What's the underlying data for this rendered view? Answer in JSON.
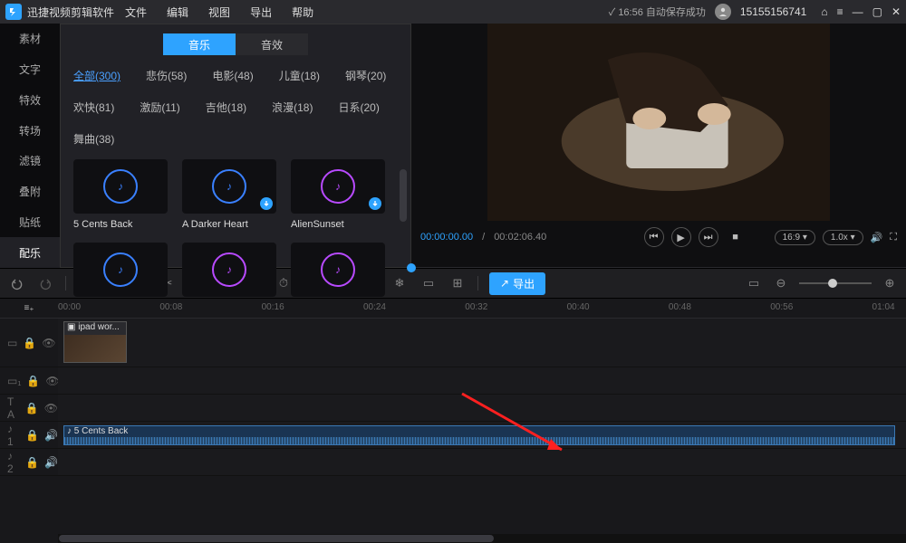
{
  "titlebar": {
    "app_name": "迅捷视频剪辑软件",
    "menus": [
      "文件",
      "编辑",
      "视图",
      "导出",
      "帮助"
    ],
    "save_status": "✓ 16:56 自动保存成功",
    "user_id": "15155156741"
  },
  "sidebar": {
    "items": [
      "素材",
      "文字",
      "特效",
      "转场",
      "滤镜",
      "叠附",
      "贴纸",
      "配乐"
    ],
    "active_index": 7
  },
  "library": {
    "tabs": {
      "music": "音乐",
      "sfx": "音效",
      "active": 0
    },
    "categories": [
      {
        "label": "全部(300)",
        "active": true
      },
      {
        "label": "悲伤(58)"
      },
      {
        "label": "电影(48)"
      },
      {
        "label": "儿童(18)"
      },
      {
        "label": "钢琴(20)"
      },
      {
        "label": "欢快(81)"
      },
      {
        "label": "激励(11)"
      },
      {
        "label": "吉他(18)"
      },
      {
        "label": "浪漫(18)"
      },
      {
        "label": "日系(20)"
      },
      {
        "label": "舞曲(38)"
      }
    ],
    "tracks": [
      {
        "name": "5 Cents Back",
        "color": "c-blue",
        "dl": false
      },
      {
        "name": "A Darker Heart",
        "color": "c-blue",
        "dl": true
      },
      {
        "name": "AlienSunset",
        "color": "c-purple",
        "dl": true
      }
    ]
  },
  "preview": {
    "cur_time": "00:00:00.00",
    "total_time": "00:02:06.40",
    "aspect": "16:9 ▾",
    "speed": "1.0x ▾"
  },
  "toolbar": {
    "export_label": "导出"
  },
  "timeline": {
    "ticks": [
      "00:00",
      "00:08",
      "00:16",
      "00:24",
      "00:32",
      "00:40",
      "00:48",
      "00:56",
      "01:04"
    ],
    "video_clip": "ipad wor...",
    "audio_clip": "5 Cents Back",
    "track_labels": {
      "a1": "♪ 1",
      "a2": "♪ 2",
      "t": "T A"
    }
  }
}
